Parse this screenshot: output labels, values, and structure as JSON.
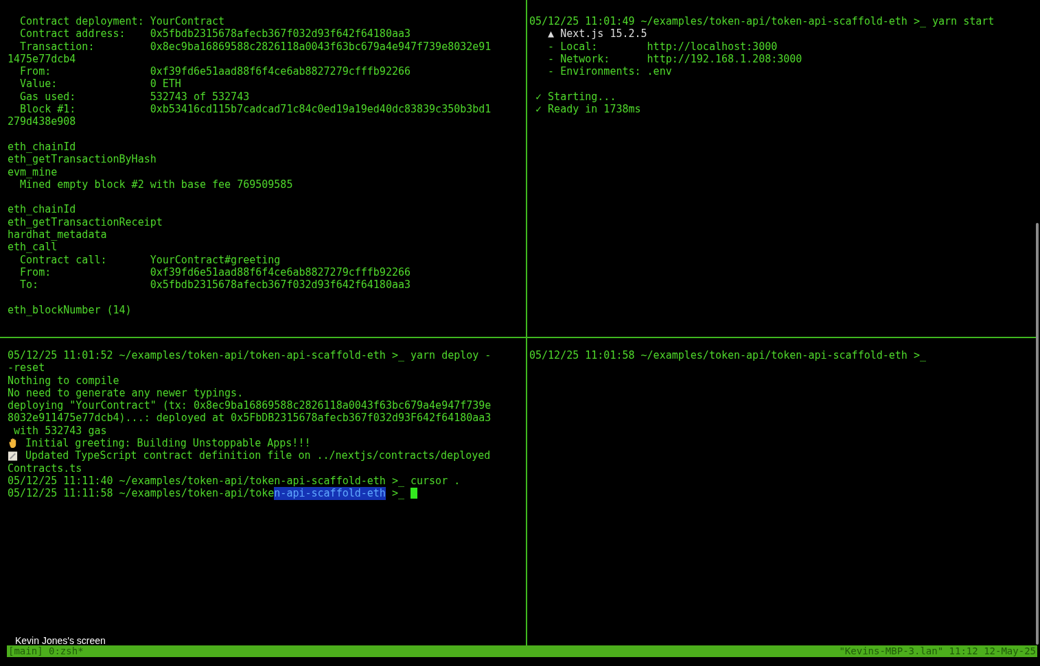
{
  "panes": [
    {
      "blocks": [
        {
          "lines": [
            {
              "text": "  Contract deployment: YourContract"
            },
            {
              "text": "  Contract address:    0x5fbdb2315678afecb367f032d93f642f64180aa3"
            },
            {
              "text": "  Transaction:         0x8ec9ba16869588c2826118a0043f63bc679a4e947f739e8032e91"
            },
            {
              "text": "1475e77dcb4"
            },
            {
              "text": "  From:                0xf39fd6e51aad88f6f4ce6ab8827279cfffb92266"
            },
            {
              "text": "  Value:               0 ETH"
            },
            {
              "text": "  Gas used:            532743 of 532743"
            },
            {
              "text": "  Block #1:            0xb53416cd115b7cadcad71c84c0ed19a19ed40dc83839c350b3bd1"
            },
            {
              "text": "279d438e908"
            }
          ]
        },
        {
          "lines": [
            {
              "text": "eth_chainId"
            },
            {
              "text": "eth_getTransactionByHash"
            },
            {
              "text": "evm_mine"
            },
            {
              "text": "  Mined empty block #2 with base fee 769509585"
            }
          ]
        },
        {
          "lines": [
            {
              "text": "eth_chainId"
            },
            {
              "text": "eth_getTransactionReceipt"
            },
            {
              "text": "hardhat_metadata"
            },
            {
              "text": "eth_call"
            },
            {
              "text": "  Contract call:       YourContract#greeting"
            },
            {
              "text": "  From:                0xf39fd6e51aad88f6f4ce6ab8827279cfffb92266"
            },
            {
              "text": "  To:                  0x5fbdb2315678afecb367f032d93f642f64180aa3"
            }
          ]
        },
        {
          "lines": [
            {
              "text": "eth_blockNumber (14)"
            }
          ]
        }
      ]
    },
    {
      "blocks": [
        {
          "lines": [
            {
              "text": "05/12/25 11:01:49 ~/examples/token-api/token-api-scaffold-eth >_ yarn start"
            },
            {
              "text": "   ▲ Next.js 15.2.5",
              "kind": "white"
            },
            {
              "text": "   - Local:        http://localhost:3000"
            },
            {
              "text": "   - Network:      http://192.168.1.208:3000"
            },
            {
              "text": "   - Environments: .env"
            }
          ]
        },
        {
          "lines": [
            {
              "text": " ✓ Starting..."
            },
            {
              "text": " ✓ Ready in 1738ms"
            }
          ]
        }
      ]
    },
    {
      "blocks": [
        {
          "lines": [
            {
              "text": "05/12/25 11:01:52 ~/examples/token-api/token-api-scaffold-eth >_ yarn deploy -"
            },
            {
              "text": "-reset"
            },
            {
              "text": "Nothing to compile"
            },
            {
              "text": "No need to generate any newer typings."
            },
            {
              "text": "deploying \"YourContract\" (tx: 0x8ec9ba16869588c2826118a0043f63bc679a4e947f739e"
            },
            {
              "text": "8032e911475e77dcb4)...: deployed at 0x5FbDB2315678afecb367f032d93F642f64180aa3"
            },
            {
              "text": " with 532743 gas"
            },
            {
              "text": " Initial greeting: Building Unstoppable Apps!!!",
              "kind": "hand"
            },
            {
              "text": " Updated TypeScript contract definition file on ../nextjs/contracts/deployed",
              "kind": "note"
            },
            {
              "text": "Contracts.ts"
            },
            {
              "text": "05/12/25 11:11:40 ~/examples/token-api/token-api-scaffold-eth >_ cursor ."
            },
            {
              "kind": "selection",
              "text": "05/12/25 11:11:58 ~/examples/token-api/toke",
              "selected": "n-api-scaffold-eth",
              "after": " >_ ",
              "cursor": true
            }
          ]
        }
      ]
    },
    {
      "blocks": [
        {
          "lines": [
            {
              "text": "05/12/25 11:01:58 ~/examples/token-api/token-api-scaffold-eth >_"
            }
          ]
        }
      ]
    }
  ],
  "share_label": "Kevin Jones's screen",
  "status_bar": {
    "left": "[main] 0:zsh*",
    "right": "\"Kevins-MBP-3.lan\" 11:12 12-May-25"
  }
}
